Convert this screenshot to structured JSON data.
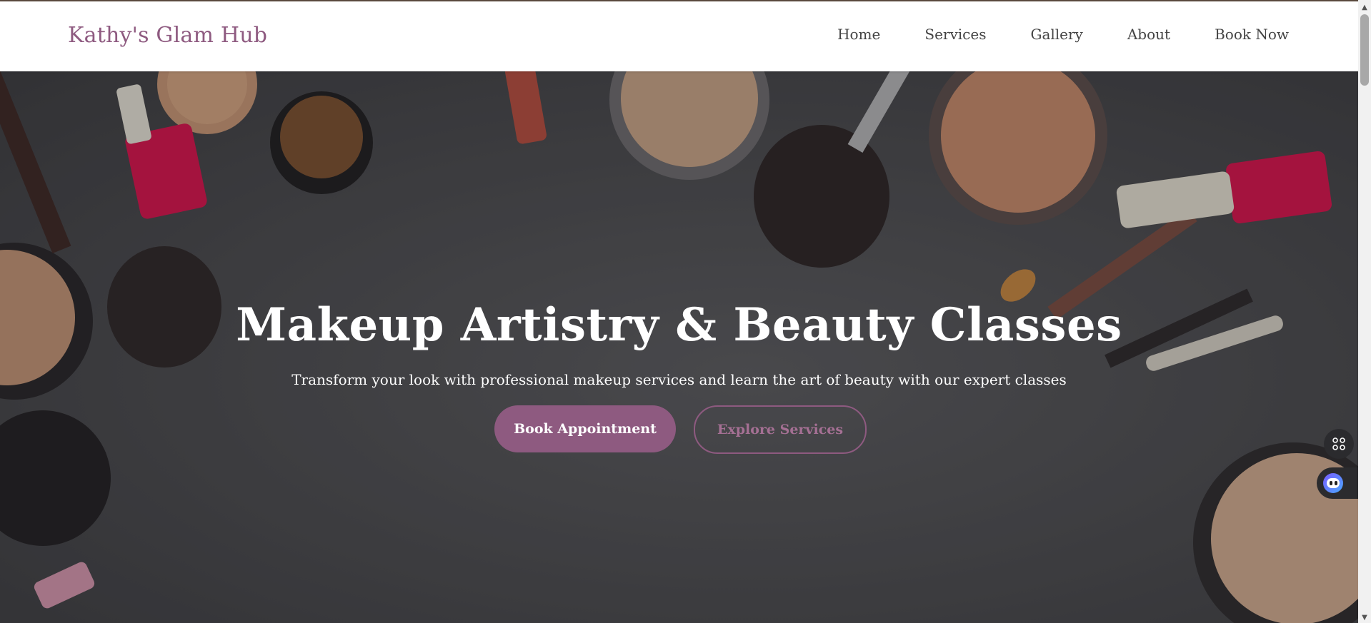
{
  "brand": {
    "name": "Kathy's Glam Hub",
    "accent": "#8e5a80"
  },
  "nav": {
    "items": [
      {
        "label": "Home"
      },
      {
        "label": "Services"
      },
      {
        "label": "Gallery"
      },
      {
        "label": "About"
      },
      {
        "label": "Book Now"
      }
    ]
  },
  "hero": {
    "title": "Makeup Artistry & Beauty Classes",
    "subtitle": "Transform your look with professional makeup services and learn the art of beauty with our expert classes",
    "primary_button": "Book Appointment",
    "secondary_button": "Explore Services",
    "background_image": "makeup-products-flatlay"
  },
  "widgets": {
    "grid_icon": "command-grid-icon",
    "assistant_icon": "assistant-face-icon"
  }
}
